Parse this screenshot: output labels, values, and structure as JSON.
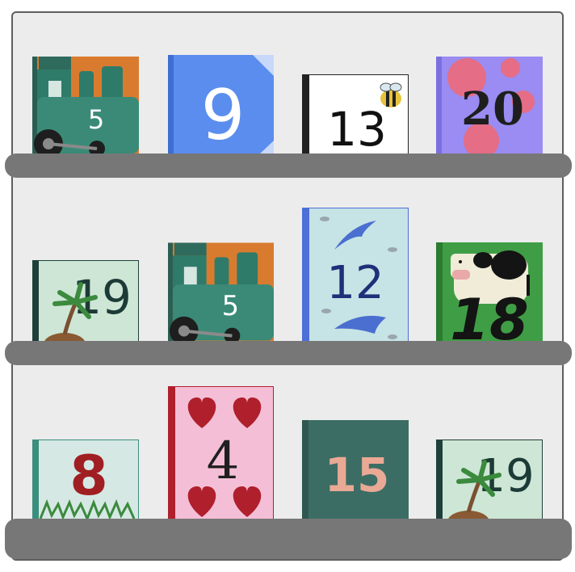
{
  "shelves": [
    {
      "books": [
        {
          "number": "5",
          "cover": "train",
          "bg": "#d97b2f",
          "accent": "#2f7b6a",
          "spine": "#2b5e53"
        },
        {
          "number": "9",
          "cover": "plain-corner",
          "bg": "#5b8def",
          "accent": "#ffffff",
          "spine": "#3c6fd0"
        },
        {
          "number": "13",
          "cover": "bee",
          "bg": "#ffffff",
          "accent": "#111111",
          "spine": "#222222"
        },
        {
          "number": "20",
          "cover": "balloons",
          "bg": "#9a8cf2",
          "accent": "#1e1e1e",
          "spine": "#7b6fe0"
        }
      ]
    },
    {
      "books": [
        {
          "number": "19",
          "cover": "island",
          "bg": "#cde6d6",
          "accent": "#1d3b36",
          "spine": "#1f3f3a"
        },
        {
          "number": "5",
          "cover": "train",
          "bg": "#d97b2f",
          "accent": "#2f7b6a",
          "spine": "#2b5e53"
        },
        {
          "number": "12",
          "cover": "dolphins",
          "bg": "#c6e3e6",
          "accent": "#1f2f78",
          "spine": "#4d6fd8"
        },
        {
          "number": "18",
          "cover": "cow",
          "bg": "#3f9e45",
          "accent": "#141414",
          "spine": "#2a7c30"
        }
      ]
    },
    {
      "books": [
        {
          "number": "8",
          "cover": "grass",
          "bg": "#d6e8e4",
          "accent": "#a01f22",
          "spine": "#3a8f7d"
        },
        {
          "number": "4",
          "cover": "hearts",
          "bg": "#f4bfd6",
          "accent": "#1f1f1f",
          "spine": "#b01f2c"
        },
        {
          "number": "15",
          "cover": "plain",
          "bg": "#3c6d64",
          "accent": "#e9a995",
          "spine": "#2f5850"
        },
        {
          "number": "19",
          "cover": "island",
          "bg": "#cde6d6",
          "accent": "#1d3b36",
          "spine": "#1f3f3a"
        }
      ]
    }
  ]
}
